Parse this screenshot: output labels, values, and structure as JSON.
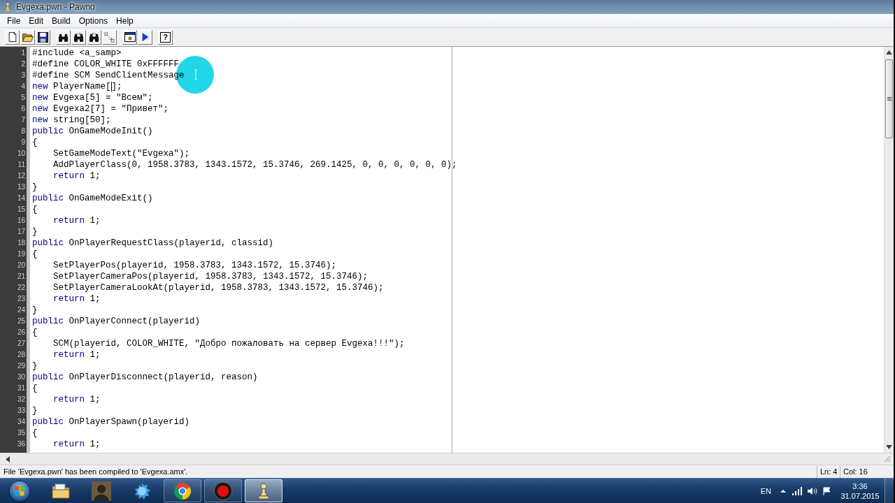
{
  "window": {
    "title": "Evgexa.pwn - Pawno"
  },
  "menu": [
    "File",
    "Edit",
    "Build",
    "Options",
    "Help"
  ],
  "toolbar": {
    "help_label": "?"
  },
  "editor": {
    "lines": [
      {
        "number": "1",
        "parts": [
          {
            "kind": "plain",
            "text": "#include <a_samp>"
          }
        ]
      },
      {
        "number": "2",
        "parts": [
          {
            "kind": "plain",
            "text": "#define COLOR_WHITE 0xFFFFFF"
          }
        ]
      },
      {
        "number": "3",
        "parts": [
          {
            "kind": "plain",
            "text": "#define SCM SendClientMessage"
          }
        ]
      },
      {
        "number": "4",
        "parts": [
          {
            "kind": "keyword",
            "text": "new"
          },
          {
            "kind": "plain",
            "text": " PlayerName["
          },
          {
            "kind": "caret"
          },
          {
            "kind": "plain",
            "text": "];"
          }
        ]
      },
      {
        "number": "5",
        "parts": [
          {
            "kind": "keyword",
            "text": "new"
          },
          {
            "kind": "plain",
            "text": " Evgexa[5] = \"Всем\";"
          }
        ]
      },
      {
        "number": "6",
        "parts": [
          {
            "kind": "keyword",
            "text": "new"
          },
          {
            "kind": "plain",
            "text": " Evgexa2[7] = \"Привет\";"
          }
        ]
      },
      {
        "number": "7",
        "parts": [
          {
            "kind": "keyword",
            "text": "new"
          },
          {
            "kind": "plain",
            "text": " string[50];"
          }
        ]
      },
      {
        "number": "8",
        "parts": [
          {
            "kind": "keyword",
            "text": "public"
          },
          {
            "kind": "plain",
            "text": " OnGameModeInit()"
          }
        ]
      },
      {
        "number": "9",
        "parts": [
          {
            "kind": "plain",
            "text": "{"
          }
        ],
        "children": [
          {
            "number": "10",
            "parts": [
              {
                "kind": "plain",
                "text": "SetGameModeText(\"Evgexa\");"
              }
            ]
          },
          {
            "number": "11",
            "parts": [
              {
                "kind": "plain",
                "text": "AddPlayerClass(0, 1958.3783, 1343.1572, 15.3746, 269.1425, 0, 0, 0, 0, 0, 0);"
              }
            ]
          },
          {
            "number": "12",
            "parts": [
              {
                "kind": "keyword",
                "text": "return"
              },
              {
                "kind": "plain",
                "text": " 1;"
              }
            ]
          }
        ]
      },
      {
        "number": "13",
        "parts": [
          {
            "kind": "plain",
            "text": "}"
          }
        ]
      },
      {
        "number": "14",
        "parts": [
          {
            "kind": "keyword",
            "text": "public"
          },
          {
            "kind": "plain",
            "text": " OnGameModeExit()"
          }
        ]
      },
      {
        "number": "15",
        "parts": [
          {
            "kind": "plain",
            "text": "{"
          }
        ],
        "children": [
          {
            "number": "16",
            "parts": [
              {
                "kind": "keyword",
                "text": "return"
              },
              {
                "kind": "plain",
                "text": " 1;"
              }
            ]
          }
        ]
      },
      {
        "number": "17",
        "parts": [
          {
            "kind": "plain",
            "text": "}"
          }
        ]
      },
      {
        "number": "18",
        "parts": [
          {
            "kind": "keyword",
            "text": "public"
          },
          {
            "kind": "plain",
            "text": " OnPlayerRequestClass(playerid, classid)"
          }
        ]
      },
      {
        "number": "19",
        "parts": [
          {
            "kind": "plain",
            "text": "{"
          }
        ],
        "children": [
          {
            "number": "20",
            "parts": [
              {
                "kind": "plain",
                "text": "SetPlayerPos(playerid, 1958.3783, 1343.1572, 15.3746);"
              }
            ]
          },
          {
            "number": "21",
            "parts": [
              {
                "kind": "plain",
                "text": "SetPlayerCameraPos(playerid, 1958.3783, 1343.1572, 15.3746);"
              }
            ]
          },
          {
            "number": "22",
            "parts": [
              {
                "kind": "plain",
                "text": "SetPlayerCameraLookAt(playerid, 1958.3783, 1343.1572, 15.3746);"
              }
            ]
          },
          {
            "number": "23",
            "parts": [
              {
                "kind": "keyword",
                "text": "return"
              },
              {
                "kind": "plain",
                "text": " 1;"
              }
            ]
          }
        ]
      },
      {
        "number": "24",
        "parts": [
          {
            "kind": "plain",
            "text": "}"
          }
        ]
      },
      {
        "number": "25",
        "parts": [
          {
            "kind": "keyword",
            "text": "public"
          },
          {
            "kind": "plain",
            "text": " OnPlayerConnect(playerid)"
          }
        ]
      },
      {
        "number": "26",
        "parts": [
          {
            "kind": "plain",
            "text": "{"
          }
        ],
        "children": [
          {
            "number": "27",
            "parts": [
              {
                "kind": "plain",
                "text": "SCM(playerid, COLOR_WHITE, \"Добро пожаловать на сервер Evgexa!!!\");"
              }
            ]
          },
          {
            "number": "28",
            "parts": [
              {
                "kind": "keyword",
                "text": "return"
              },
              {
                "kind": "plain",
                "text": " 1;"
              }
            ]
          }
        ]
      },
      {
        "number": "29",
        "parts": [
          {
            "kind": "plain",
            "text": "}"
          }
        ]
      },
      {
        "number": "30",
        "parts": [
          {
            "kind": "keyword",
            "text": "public"
          },
          {
            "kind": "plain",
            "text": " OnPlayerDisconnect(playerid, reason)"
          }
        ]
      },
      {
        "number": "31",
        "parts": [
          {
            "kind": "plain",
            "text": "{"
          }
        ],
        "children": [
          {
            "number": "32",
            "parts": [
              {
                "kind": "keyword",
                "text": "return"
              },
              {
                "kind": "plain",
                "text": " 1;"
              }
            ]
          }
        ]
      },
      {
        "number": "33",
        "parts": [
          {
            "kind": "plain",
            "text": "}"
          }
        ]
      },
      {
        "number": "34",
        "parts": [
          {
            "kind": "keyword",
            "text": "public"
          },
          {
            "kind": "plain",
            "text": " OnPlayerSpawn(playerid)"
          }
        ]
      },
      {
        "number": "35",
        "parts": [
          {
            "kind": "plain",
            "text": "{"
          }
        ],
        "children": [
          {
            "number": "36",
            "parts": [
              {
                "kind": "keyword",
                "text": "return"
              },
              {
                "kind": "plain",
                "text": " 1;"
              }
            ]
          }
        ]
      }
    ]
  },
  "status_bar": {
    "message": "File 'Evgexa.pwn' has been compiled to 'Evgexa.amx'.",
    "line": "Ln: 4",
    "column": "Col: 16"
  },
  "taskbar": {
    "apps": [
      {
        "running": false,
        "selected": false
      },
      {
        "running": false,
        "selected": false
      },
      {
        "running": false,
        "selected": false
      },
      {
        "running": true,
        "selected": false
      },
      {
        "running": true,
        "selected": false
      },
      {
        "running": true,
        "selected": true
      }
    ],
    "language": "EN",
    "time": "3:36",
    "date": "31.07.2015"
  }
}
